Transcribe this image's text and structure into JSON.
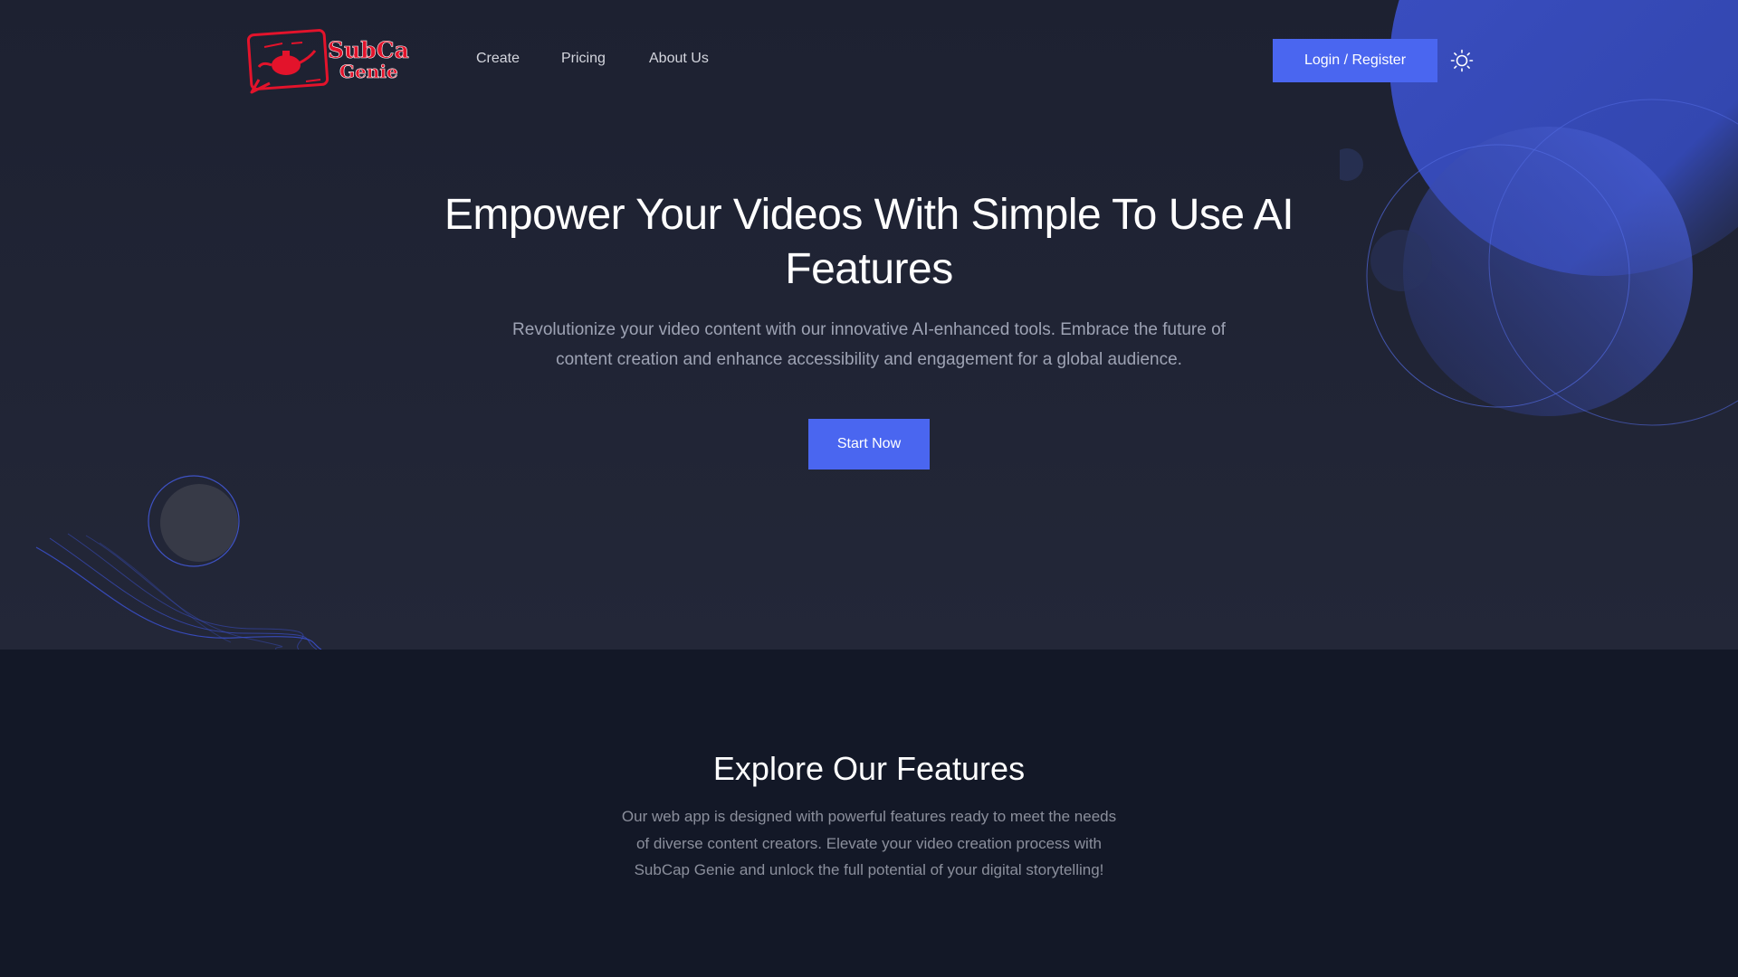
{
  "brand": {
    "logo_line1": "SubCap",
    "logo_line2": "Genie",
    "logo_icon": "genie-lamp-icon",
    "logo_color": "#e3132b"
  },
  "nav": {
    "links": [
      {
        "label": "Create"
      },
      {
        "label": "Pricing"
      },
      {
        "label": "About Us"
      }
    ],
    "login_label": "Login / Register",
    "theme_icon": "sun-icon"
  },
  "hero": {
    "title": "Empower Your Videos With Simple To Use AI Features",
    "subtitle": "Revolutionize your video content with our innovative AI-enhanced tools. Embrace the future of content creation and enhance accessibility and engagement for a global audience.",
    "cta_label": "Start Now"
  },
  "features": {
    "title": "Explore Our Features",
    "description": "Our web app is designed with powerful features ready to meet the needs of diverse content creators. Elevate your video creation process with SubCap Genie and unlock the full potential of your digital storytelling!"
  },
  "colors": {
    "accent": "#4a66f0",
    "hero_background": "#1f2333",
    "features_background": "#131827",
    "heading": "#ffffff",
    "body_text": "#9ea3b4"
  }
}
